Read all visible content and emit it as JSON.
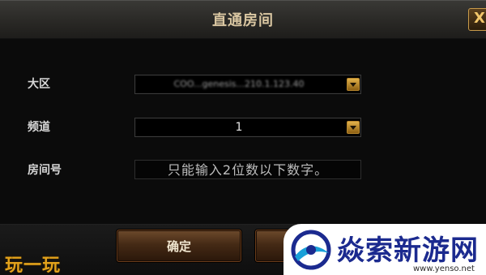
{
  "dialog": {
    "title": "直通房间",
    "close_label": "X"
  },
  "form": {
    "region_label": "大区",
    "region_value": "COO...genesis...210.1.123.40",
    "channel_label": "频道",
    "channel_value": "1",
    "room_label": "房间号",
    "room_placeholder": "只能输入2位数以下数字。"
  },
  "buttons": {
    "ok_label": "确定"
  },
  "watermarks": {
    "left_text": "玩一玩",
    "right_text": "焱索新游网",
    "right_url": "www.yenso.net"
  },
  "colors": {
    "accent_gold": "#e2b24a",
    "title_text": "#d9c6a1",
    "button_brown": "#452a15",
    "watermark_blue": "#1b2a8f",
    "watermark_orange": "#e2a21b"
  },
  "icons": {
    "close": "close-icon",
    "dropdown": "chevron-down-icon",
    "watermark_logo": "logo-icon"
  }
}
